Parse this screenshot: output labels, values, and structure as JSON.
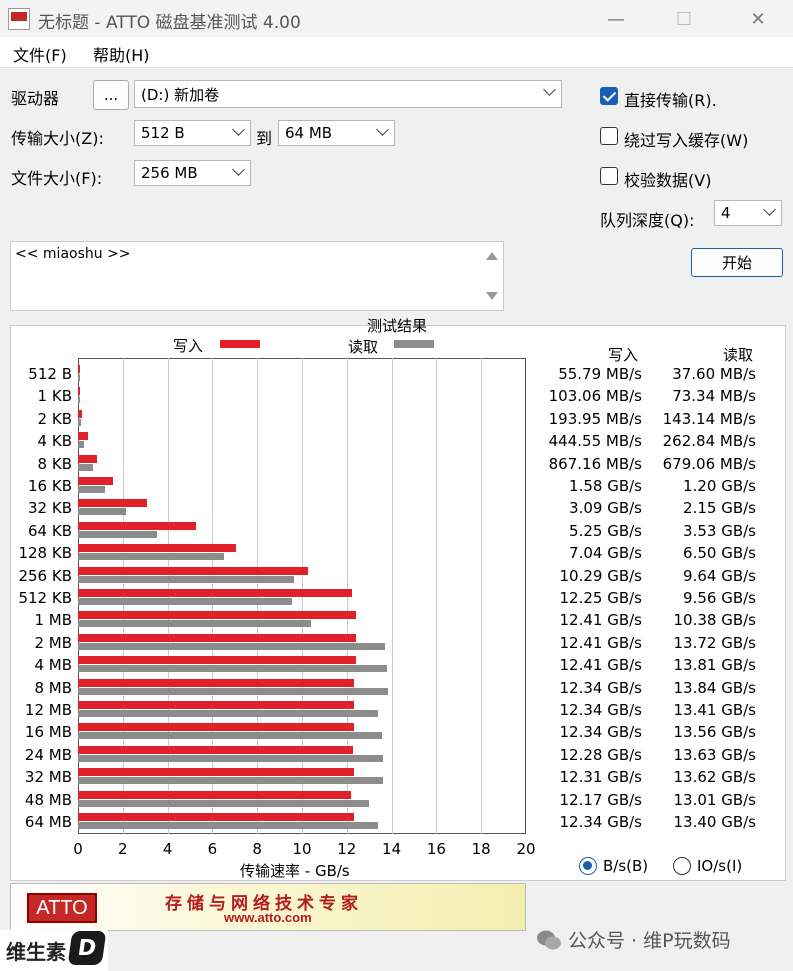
{
  "window": {
    "title": "无标题 - ATTO 磁盘基准测试 4.00",
    "minimize": "—",
    "maximize": "☐",
    "close": "✕"
  },
  "menu": [
    {
      "label": "文件(F)"
    },
    {
      "label": "帮助(H)"
    }
  ],
  "drive": {
    "label": "驱动器",
    "browse": "...",
    "value": "(D:) 新加卷"
  },
  "transfer": {
    "label": "传输大小(Z):",
    "from": "512 B",
    "to_label": "到",
    "to": "64 MB"
  },
  "file_size": {
    "label": "文件大小(F):",
    "value": "256 MB"
  },
  "options": {
    "direct_io": {
      "label": "直接传输(R).",
      "checked": true
    },
    "bypass_cache": {
      "label": "绕过写入缓存(W)",
      "checked": false
    },
    "verify": {
      "label": "校验数据(V)",
      "checked": false
    }
  },
  "queue": {
    "label": "队列深度(Q):",
    "value": "4"
  },
  "start_button": "开始",
  "description": "<< miaoshu >>",
  "results": {
    "title": "测试结果",
    "legend_write": "写入",
    "legend_read": "读取",
    "col_write": "写入",
    "col_read": "读取",
    "xlabel": "传输速率 - GB/s",
    "write_color": "#e0212a",
    "read_color": "#8c8c8c"
  },
  "chart_data": {
    "type": "bar",
    "orientation": "horizontal",
    "xlabel": "传输速率 - GB/s",
    "xlim": [
      0,
      20
    ],
    "xticks": [
      "0",
      "2",
      "4",
      "6",
      "8",
      "10",
      "12",
      "14",
      "16",
      "18",
      "20"
    ],
    "grid": true,
    "categories": [
      "512 B",
      "1 KB",
      "2 KB",
      "4 KB",
      "8 KB",
      "16 KB",
      "32 KB",
      "64 KB",
      "128 KB",
      "256 KB",
      "512 KB",
      "1 MB",
      "2 MB",
      "4 MB",
      "8 MB",
      "12 MB",
      "16 MB",
      "24 MB",
      "32 MB",
      "48 MB",
      "64 MB"
    ],
    "series": [
      {
        "name": "写入",
        "color": "#e0212a",
        "values": [
          0.05579,
          0.10306,
          0.19395,
          0.44455,
          0.86716,
          1.58,
          3.09,
          5.25,
          7.04,
          10.29,
          12.25,
          12.41,
          12.41,
          12.41,
          12.34,
          12.34,
          12.34,
          12.28,
          12.31,
          12.17,
          12.34
        ],
        "labels": [
          "55.79 MB/s",
          "103.06 MB/s",
          "193.95 MB/s",
          "444.55 MB/s",
          "867.16 MB/s",
          "1.58 GB/s",
          "3.09 GB/s",
          "5.25 GB/s",
          "7.04 GB/s",
          "10.29 GB/s",
          "12.25 GB/s",
          "12.41 GB/s",
          "12.41 GB/s",
          "12.41 GB/s",
          "12.34 GB/s",
          "12.34 GB/s",
          "12.34 GB/s",
          "12.28 GB/s",
          "12.31 GB/s",
          "12.17 GB/s",
          "12.34 GB/s"
        ]
      },
      {
        "name": "读取",
        "color": "#8c8c8c",
        "values": [
          0.0376,
          0.07334,
          0.14314,
          0.26284,
          0.67906,
          1.2,
          2.15,
          3.53,
          6.5,
          9.64,
          9.56,
          10.38,
          13.72,
          13.81,
          13.84,
          13.41,
          13.56,
          13.63,
          13.62,
          13.01,
          13.4
        ],
        "labels": [
          "37.60 MB/s",
          "73.34 MB/s",
          "143.14 MB/s",
          "262.84 MB/s",
          "679.06 MB/s",
          "1.20 GB/s",
          "2.15 GB/s",
          "3.53 GB/s",
          "6.50 GB/s",
          "9.64 GB/s",
          "9.56 GB/s",
          "10.38 GB/s",
          "13.72 GB/s",
          "13.81 GB/s",
          "13.84 GB/s",
          "13.41 GB/s",
          "13.56 GB/s",
          "13.63 GB/s",
          "13.62 GB/s",
          "13.01 GB/s",
          "13.40 GB/s"
        ]
      }
    ]
  },
  "units": {
    "bytes": {
      "label": "B/s(B)",
      "selected": true
    },
    "io": {
      "label": "IO/s(I)",
      "selected": false
    }
  },
  "banner": {
    "logo": "ATTO",
    "slogan": "存储与网络技术专家",
    "url": "www.atto.com"
  },
  "watermark": {
    "left_text": "维生素",
    "left_badge": "D",
    "right_text": "公众号 · 维P玩数码"
  }
}
